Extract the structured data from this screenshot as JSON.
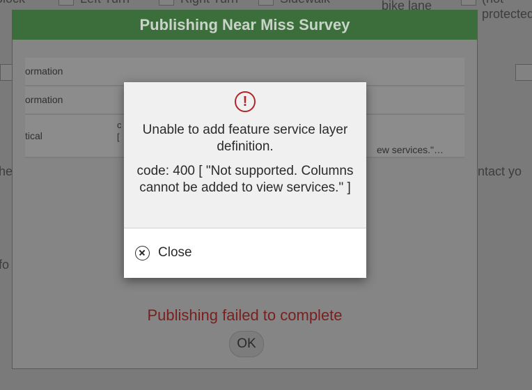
{
  "background": {
    "options_row": [
      "Block",
      "Left Turn",
      "Right Turn",
      "Sidewalk",
      "bike lane",
      "(not",
      "protected"
    ],
    "left_fragment_1": "he",
    "left_fragment_2": "fo",
    "right_fragment": "ntact yo"
  },
  "publish_dialog": {
    "title": "Publishing Near Miss Survey",
    "rows": [
      {
        "left": "ormation",
        "mid": "",
        "right": ""
      },
      {
        "left": "ormation",
        "mid": "",
        "right": ""
      },
      {
        "left": "tical",
        "mid_1": "c",
        "mid_2": "[",
        "right": "ew services.\"…"
      }
    ],
    "status": "Publishing failed to complete",
    "ok_label": "OK"
  },
  "alert": {
    "icon": "exclamation-circle-icon",
    "icon_glyph": "!",
    "title": "Unable to add feature service layer definition.",
    "message": "code: 400 [ \"Not supported. Columns cannot be added to view services.\" ]",
    "close_label": "Close"
  },
  "colors": {
    "header_green": "#3c6e3c",
    "error_red": "#b3232a"
  }
}
